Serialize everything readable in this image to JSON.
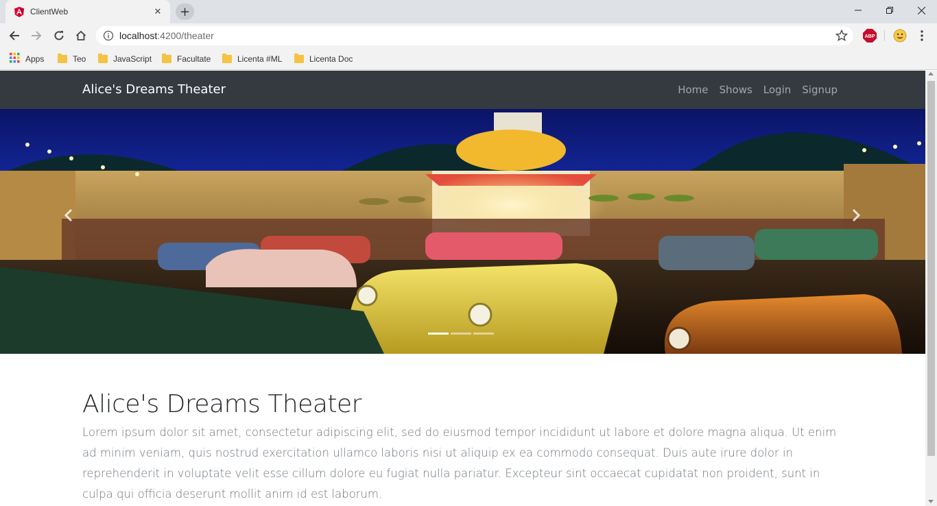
{
  "browser": {
    "tab_title": "ClientWeb",
    "url_host": "localhost",
    "url_path": ":4200/theater",
    "bookmarks": [
      {
        "label": "Apps",
        "icon": "apps-grid-icon"
      },
      {
        "label": "Teo",
        "icon": "folder-icon"
      },
      {
        "label": "JavaScript",
        "icon": "folder-icon"
      },
      {
        "label": "Facultate",
        "icon": "folder-icon"
      },
      {
        "label": "Licenta #ML",
        "icon": "folder-icon"
      },
      {
        "label": "Licenta Doc",
        "icon": "folder-icon"
      }
    ],
    "extensions": [
      {
        "label": "ABP",
        "color": "#c70d2c"
      }
    ]
  },
  "navbar": {
    "brand": "Alice's Dreams Theater",
    "links": [
      {
        "label": "Home"
      },
      {
        "label": "Shows"
      },
      {
        "label": "Login"
      },
      {
        "label": "Signup"
      }
    ],
    "background": "#343a40"
  },
  "carousel": {
    "indicators": [
      {
        "active": true
      },
      {
        "active": false
      },
      {
        "active": false
      }
    ],
    "image_description_icon": "drive-in-theater-photo"
  },
  "jumbotron": {
    "heading": "Alice's Dreams Theater",
    "lead": "Lorem ipsum dolor sit amet, consectetur adipiscing elit, sed do eiusmod tempor incididunt ut labore et dolore magna aliqua. Ut enim ad minim veniam, quis nostrud exercitation ullamco laboris nisi ut aliquip ex ea commodo consequat. Duis aute irure dolor in reprehenderit in voluptate velit esse cillum dolore eu fugiat nulla pariatur. Excepteur sint occaecat cupidatat non proident, sunt in culpa qui officia deserunt mollit anim id est laborum."
  }
}
